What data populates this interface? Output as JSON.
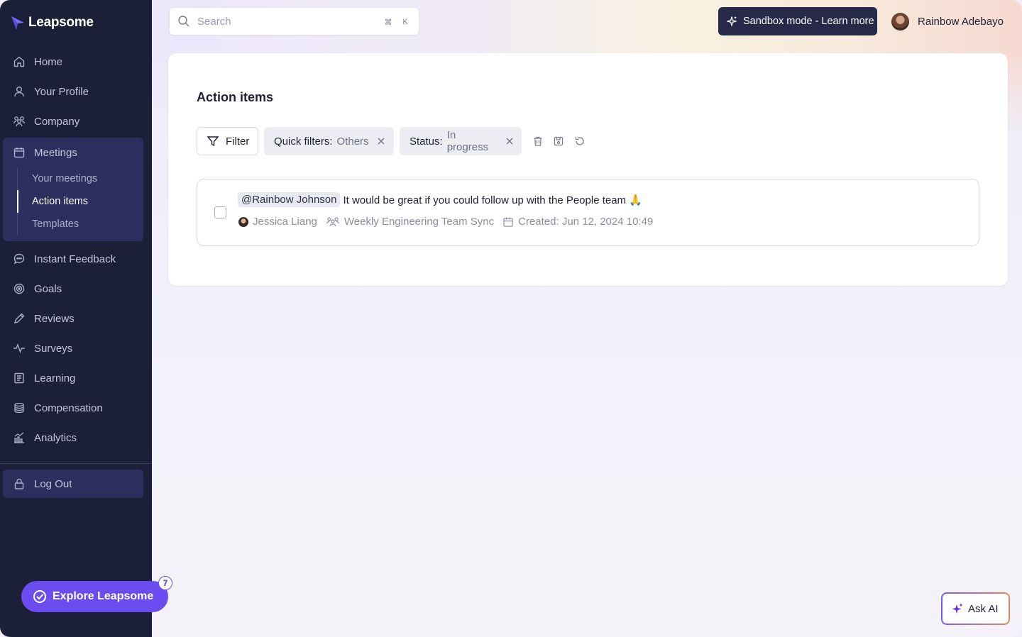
{
  "app": {
    "brand": "Leapsome"
  },
  "sidebar": {
    "items": [
      {
        "label": "Home",
        "icon": "home-icon"
      },
      {
        "label": "Your Profile",
        "icon": "user-icon"
      },
      {
        "label": "Company",
        "icon": "users-icon"
      }
    ],
    "meetings": {
      "label": "Meetings",
      "icon": "calendar-icon",
      "subitems": [
        {
          "label": "Your meetings",
          "active": false
        },
        {
          "label": "Action items",
          "active": true
        },
        {
          "label": "Templates",
          "active": false
        }
      ]
    },
    "items_after": [
      {
        "label": "Instant Feedback",
        "icon": "chat-icon"
      },
      {
        "label": "Goals",
        "icon": "target-icon"
      },
      {
        "label": "Reviews",
        "icon": "pencil-icon"
      },
      {
        "label": "Surveys",
        "icon": "pulse-icon"
      },
      {
        "label": "Learning",
        "icon": "book-icon"
      },
      {
        "label": "Compensation",
        "icon": "coins-icon"
      },
      {
        "label": "Analytics",
        "icon": "chart-icon"
      }
    ],
    "logout": "Log Out",
    "explore": {
      "label": "Explore Leapsome",
      "badge": "7"
    }
  },
  "topbar": {
    "search_placeholder": "Search",
    "shortcut_mod": "⌘",
    "shortcut_key": "K",
    "sandbox_label": "Sandbox mode - Learn more",
    "user_name": "Rainbow Adebayo"
  },
  "main": {
    "title": "Action items",
    "filter_label": "Filter",
    "chips": [
      {
        "key": "Quick filters:",
        "value": "Others"
      },
      {
        "key": "Status:",
        "value": "In progress"
      }
    ],
    "action_item": {
      "mention": "@Rainbow Johnson",
      "text": "It would be great if you could follow up with the People team 🙏",
      "assignee": "Jessica Liang",
      "meeting": "Weekly Engineering Team Sync",
      "created": "Created: Jun 12, 2024 10:49"
    }
  },
  "ask_ai": "Ask AI",
  "colors": {
    "sidebar_bg": "#1c1f38",
    "sidebar_active": "#2b2f5e",
    "accent": "#6a4cf0"
  }
}
